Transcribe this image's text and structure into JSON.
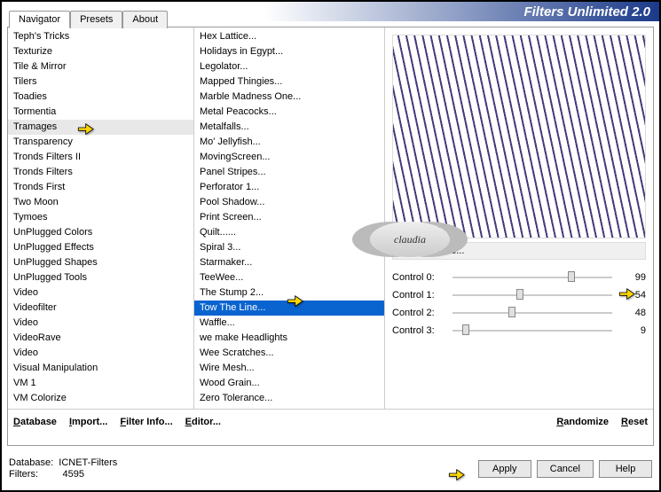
{
  "title": "Filters Unlimited 2.0",
  "tabs": [
    "Navigator",
    "Presets",
    "About"
  ],
  "active_tab": 0,
  "categories": [
    "Teph's Tricks",
    "Texturize",
    "Tile & Mirror",
    "Tilers",
    "Toadies",
    "Tormentia",
    "Tramages",
    "Transparency",
    "Tronds Filters II",
    "Tronds Filters",
    "Tronds First",
    "Two Moon",
    "Tymoes",
    "UnPlugged Colors",
    "UnPlugged Effects",
    "UnPlugged Shapes",
    "UnPlugged Tools",
    "Video",
    "Videofilter",
    "Video",
    "VideoRave",
    "Video",
    "Visual Manipulation",
    "VM 1",
    "VM Colorize"
  ],
  "highlight_cat": "Tramages",
  "filters": [
    "Hex Lattice...",
    "Holidays in Egypt...",
    "Legolator...",
    "Mapped Thingies...",
    "Marble Madness One...",
    "Metal Peacocks...",
    "Metalfalls...",
    "Mo' Jellyfish...",
    "MovingScreen...",
    "Panel Stripes...",
    "Perforator 1...",
    "Pool Shadow...",
    "Print Screen...",
    "Quilt......",
    "Spiral 3...",
    "Starmaker...",
    "TeeWee...",
    "The Stump 2...",
    "Tow The Line...",
    "Waffle...",
    "we make Headlights",
    "Wee Scratches...",
    "Wire Mesh...",
    "Wood Grain...",
    "Zero Tolerance..."
  ],
  "selected_filter": "Tow The Line...",
  "controls": [
    {
      "label": "Control 0:",
      "value": 99,
      "pos": 72
    },
    {
      "label": "Control 1:",
      "value": 54,
      "pos": 40
    },
    {
      "label": "Control 2:",
      "value": 48,
      "pos": 35
    },
    {
      "label": "Control 3:",
      "value": 9,
      "pos": 6
    }
  ],
  "bottom_buttons": {
    "database": "Database",
    "import": "Import...",
    "filterinfo": "Filter Info...",
    "editor": "Editor...",
    "randomize": "Randomize",
    "reset": "Reset"
  },
  "footer": {
    "db_label": "Database:",
    "db_val": "ICNET-Filters",
    "flt_label": "Filters:",
    "flt_val": "4595"
  },
  "action_buttons": {
    "apply": "Apply",
    "cancel": "Cancel",
    "help": "Help"
  },
  "watermark": "claudia"
}
